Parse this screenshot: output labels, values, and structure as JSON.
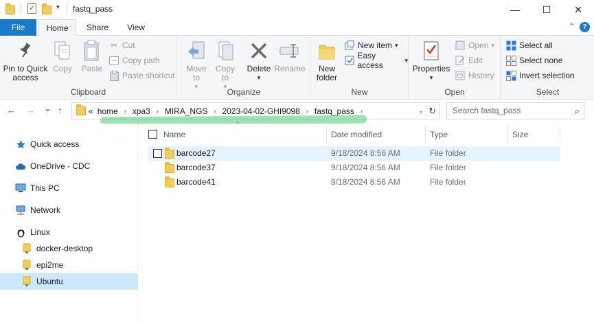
{
  "window": {
    "title": "fastq_pass",
    "quick_access_dropdown": "▾",
    "minimize": "—",
    "maximize": "☐",
    "close": "✕"
  },
  "tabs": [
    {
      "label": "File"
    },
    {
      "label": "Home"
    },
    {
      "label": "Share"
    },
    {
      "label": "View"
    }
  ],
  "ribbon_controls": {
    "collapse": "⌃",
    "help": "?"
  },
  "ribbon": {
    "clipboard": {
      "label": "Clipboard",
      "pin": "Pin to Quick access",
      "copy": "Copy",
      "paste": "Paste",
      "cut": "Cut",
      "copy_path": "Copy path",
      "paste_shortcut": "Paste shortcut"
    },
    "organize": {
      "label": "Organize",
      "move_to": "Move to",
      "copy_to": "Copy to",
      "delete": "Delete",
      "rename": "Rename"
    },
    "new": {
      "label": "New",
      "new_folder": "New folder",
      "new_item": "New item",
      "easy_access": "Easy access"
    },
    "open": {
      "label": "Open",
      "properties": "Properties",
      "open": "Open",
      "edit": "Edit",
      "history": "History"
    },
    "select": {
      "label": "Select",
      "select_all": "Select all",
      "select_none": "Select none",
      "invert_selection": "Invert selection"
    }
  },
  "address": {
    "overflow": "«",
    "crumbs": [
      "home",
      "xpa3",
      "MIRA_NGS",
      "2023-04-02-GHI9098",
      "fastq_pass"
    ],
    "separator": "›",
    "search_placeholder": "Search fastq_pass"
  },
  "nav_glyphs": {
    "back": "←",
    "forward": "→",
    "recent": "⌄",
    "up": "↑",
    "dropdown": "⌄",
    "refresh": "↻",
    "search": "⌕"
  },
  "navpane": {
    "items": [
      {
        "label": "Quick access"
      },
      {
        "label": "OneDrive - CDC"
      },
      {
        "label": "This PC"
      },
      {
        "label": "Network"
      },
      {
        "label": "Linux"
      },
      {
        "label": "docker-desktop"
      },
      {
        "label": "epi2me"
      },
      {
        "label": "Ubuntu"
      }
    ]
  },
  "columns": {
    "name": "Name",
    "date": "Date modified",
    "type": "Type",
    "size": "Size",
    "sort_glyph": "⌃"
  },
  "files": [
    {
      "name": "barcode27",
      "date": "9/18/2024 8:56 AM",
      "type": "File folder"
    },
    {
      "name": "barcode37",
      "date": "9/18/2024 8:56 AM",
      "type": "File folder"
    },
    {
      "name": "barcode41",
      "date": "9/18/2024 8:56 AM",
      "type": "File folder"
    }
  ],
  "colors": {
    "file_tab": "#1979ca",
    "selection": "#cce8ff",
    "hover_row": "#e5f3ff",
    "folder": "#f3cd5b",
    "annotation_highlight": "#50c878"
  }
}
